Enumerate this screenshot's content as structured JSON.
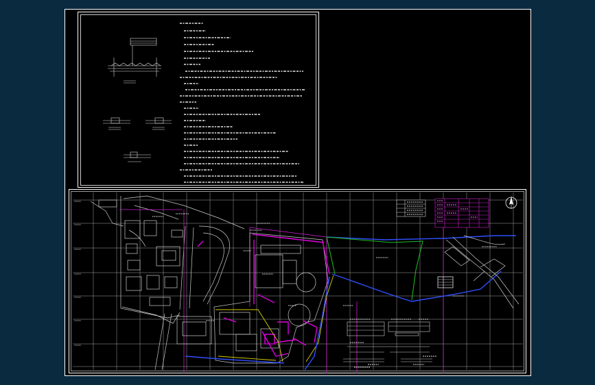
{
  "colors": {
    "background": "#0a2a40",
    "sheet": "#000000",
    "frame": "#ffffff",
    "road": "#c8c8c8",
    "boundary": "#d020d0",
    "pipe_blue": "#3050ff",
    "pipe_green": "#20c020",
    "building": "#c0c0c0",
    "highlight": "#e000e0",
    "yellow": "#d8d000"
  },
  "icons": {
    "north_arrow": "north-arrow-icon",
    "coordinate_grid": "coordinate-grid"
  }
}
